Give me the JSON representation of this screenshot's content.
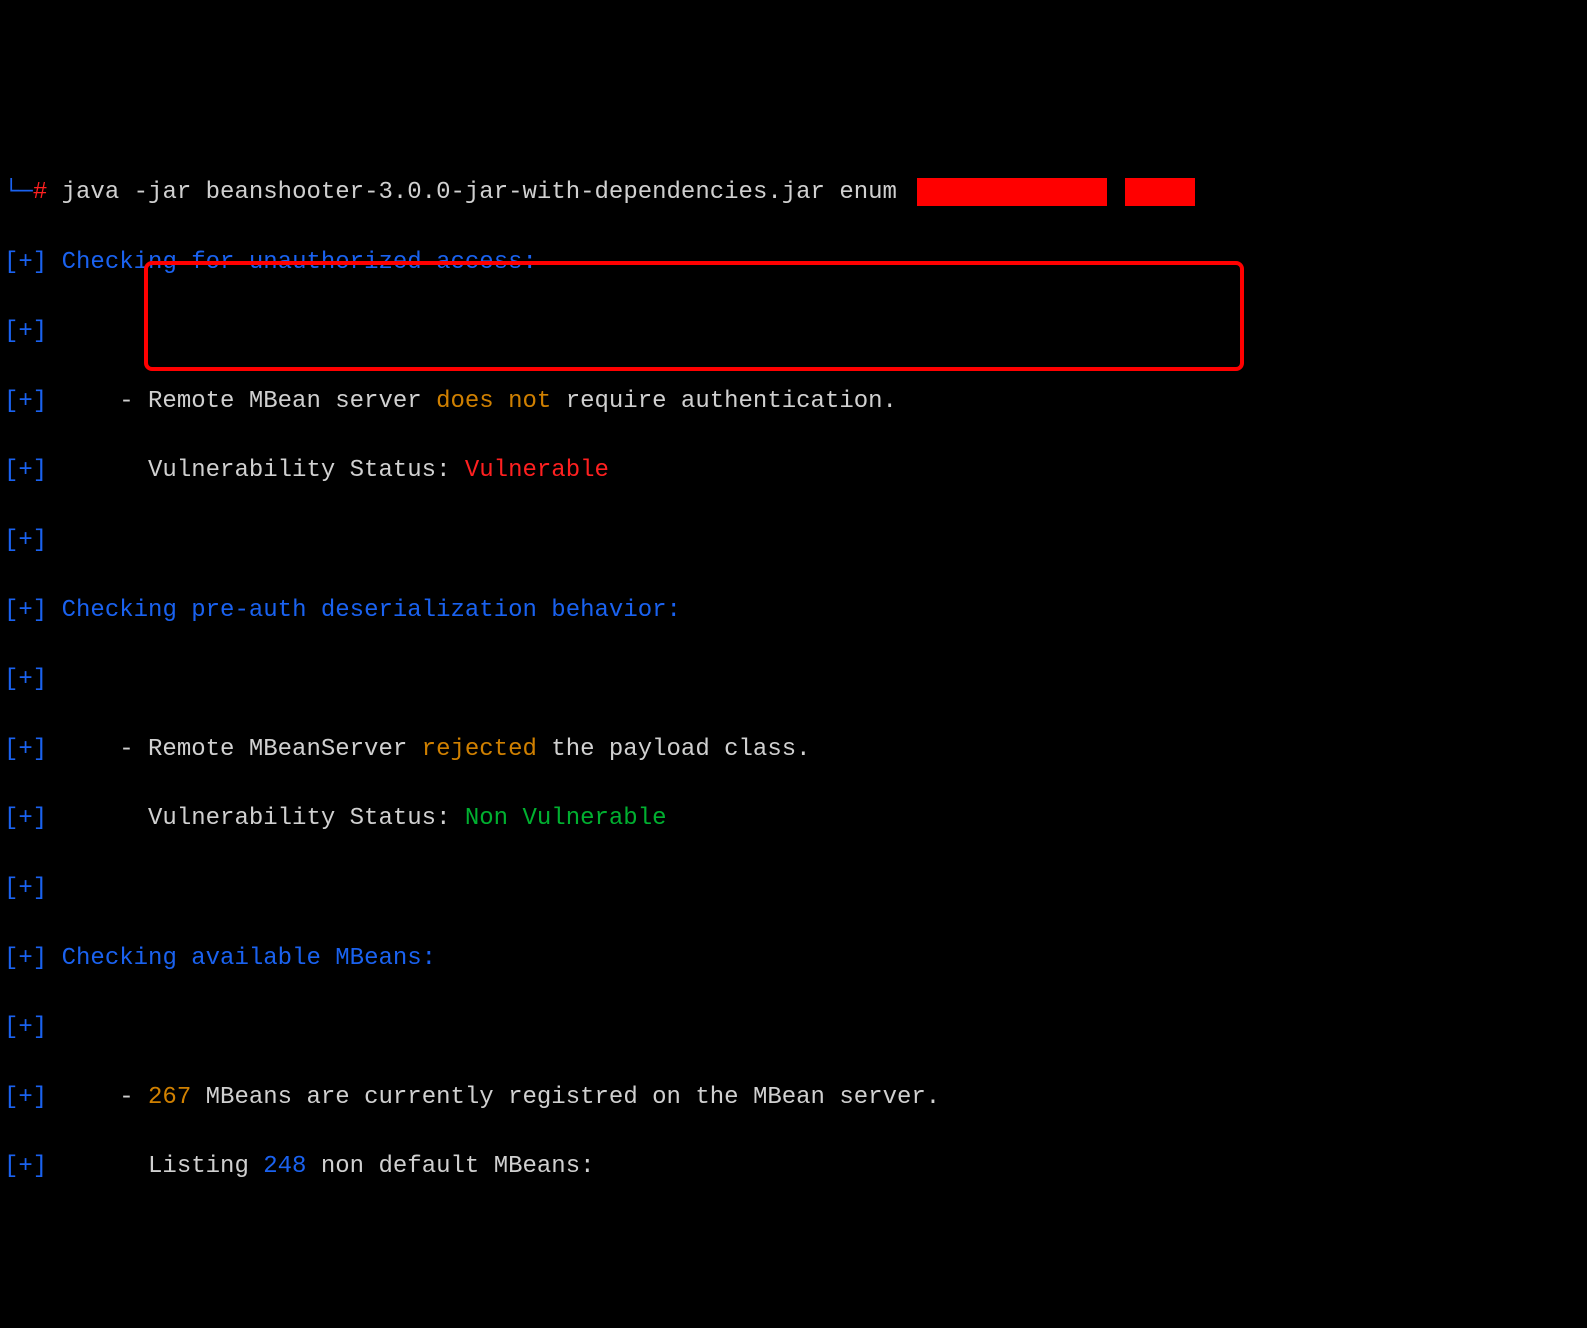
{
  "prompt": {
    "corner": "└─",
    "hash": "#"
  },
  "command": "java -jar beanshooter-3.0.0-jar-with-dependencies.jar enum ",
  "plus": "[+]",
  "sections": {
    "unauth": {
      "header": "Checking for unauthorized access:",
      "line1_pre": "\t- Remote MBean server ",
      "line1_highlight": "does not",
      "line1_post": " require authentication.",
      "line2_pre": "\t  Vulnerability Status: ",
      "line2_status": "Vulnerable"
    },
    "deserial": {
      "header": "Checking pre-auth deserialization behavior:",
      "line1_pre": "\t- Remote MBeanServer ",
      "line1_highlight": "rejected",
      "line1_post": " the payload class.",
      "line2_pre": "\t  Vulnerability Status: ",
      "line2_status": "Non Vulnerable"
    },
    "mbeans": {
      "header": "Checking available MBeans:",
      "line1_pre": "\t- ",
      "line1_num": "267",
      "line1_post": " MBeans are currently registred on the MBean server.",
      "line2_pre": "\t  Listing ",
      "line2_num": "248",
      "line2_post": " non default MBeans:"
    }
  }
}
